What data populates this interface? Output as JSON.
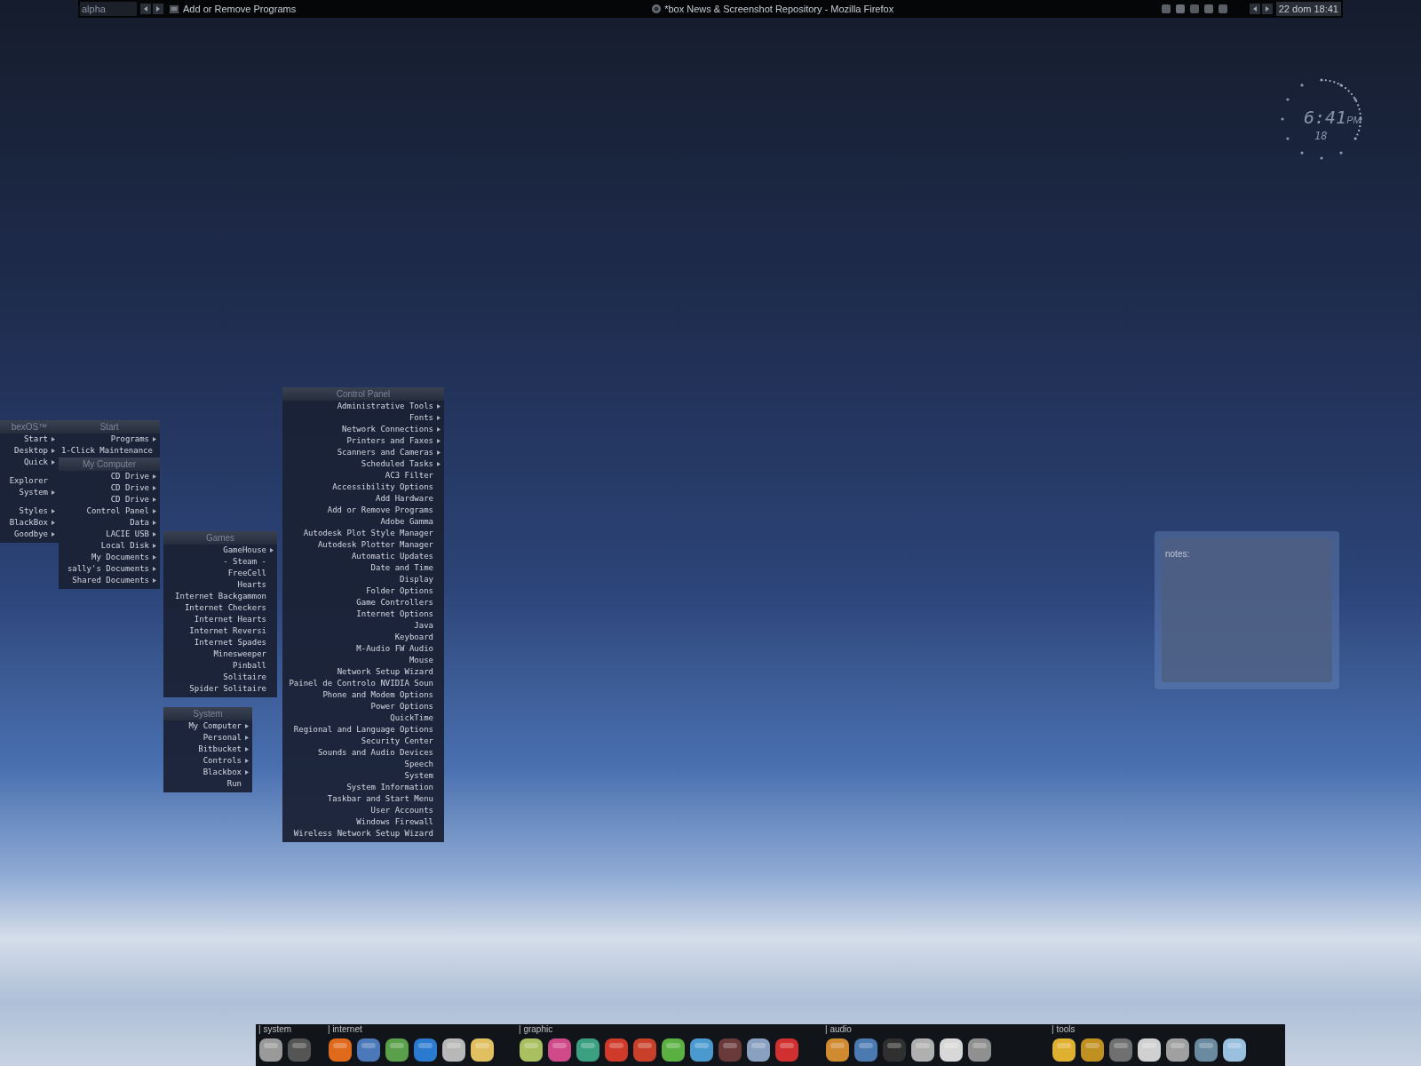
{
  "top_bar": {
    "workspace": "alpha",
    "window_label": "Add or Remove Programs",
    "title": "*box News & Screenshot Repository - Mozilla Firefox",
    "clock": "22 dom 18:41"
  },
  "clock_widget": {
    "time": "6:41",
    "suffix": "PM",
    "day": "18"
  },
  "notes": {
    "label": "notes:"
  },
  "menus": [
    {
      "title": "bexOS™",
      "groups": [
        [
          {
            "label": "Start",
            "submenu": true
          },
          {
            "label": "Desktop",
            "submenu": true
          },
          {
            "label": "Quick",
            "submenu": true
          }
        ],
        [
          {
            "label": "Explorer",
            "submenu": false
          },
          {
            "label": "System",
            "submenu": true
          }
        ],
        [
          {
            "label": "Styles",
            "submenu": true
          },
          {
            "label": "BlackBox",
            "submenu": true
          },
          {
            "label": "Goodbye",
            "submenu": true
          }
        ]
      ]
    },
    {
      "title": "Start",
      "groups": [
        [
          {
            "label": "Programs",
            "submenu": true
          },
          {
            "label": "1-Click Maintenance",
            "submenu": false
          }
        ]
      ]
    },
    {
      "title": "My Computer",
      "groups": [
        [
          {
            "label": "CD Drive",
            "submenu": true
          },
          {
            "label": "CD Drive",
            "submenu": true
          },
          {
            "label": "CD Drive",
            "submenu": true
          },
          {
            "label": "Control Panel",
            "submenu": true
          },
          {
            "label": "Data",
            "submenu": true
          },
          {
            "label": "LACIE USB",
            "submenu": true
          },
          {
            "label": "Local Disk",
            "submenu": true
          },
          {
            "label": "My Documents",
            "submenu": true
          },
          {
            "label": "sally's Documents",
            "submenu": true
          },
          {
            "label": "Shared Documents",
            "submenu": true
          }
        ]
      ]
    },
    {
      "title": "Games",
      "groups": [
        [
          {
            "label": "GameHouse",
            "submenu": true
          },
          {
            "label": "- Steam -",
            "submenu": false
          },
          {
            "label": "FreeCell",
            "submenu": false
          },
          {
            "label": "Hearts",
            "submenu": false
          },
          {
            "label": "Internet Backgammon",
            "submenu": false
          },
          {
            "label": "Internet Checkers",
            "submenu": false
          },
          {
            "label": "Internet Hearts",
            "submenu": false
          },
          {
            "label": "Internet Reversi",
            "submenu": false
          },
          {
            "label": "Internet Spades",
            "submenu": false
          },
          {
            "label": "Minesweeper",
            "submenu": false
          },
          {
            "label": "Pinball",
            "submenu": false
          },
          {
            "label": "Solitaire",
            "submenu": false
          },
          {
            "label": "Spider Solitaire",
            "submenu": false
          }
        ]
      ]
    },
    {
      "title": "System",
      "groups": [
        [
          {
            "label": "My Computer",
            "submenu": true
          },
          {
            "label": "Personal",
            "submenu": true
          },
          {
            "label": "Bitbucket",
            "submenu": true
          },
          {
            "label": "Controls",
            "submenu": true
          },
          {
            "label": "Blackbox",
            "submenu": true
          },
          {
            "label": "Run",
            "submenu": false
          }
        ]
      ]
    },
    {
      "title": "Control Panel",
      "groups": [
        [
          {
            "label": "Administrative Tools",
            "submenu": true
          },
          {
            "label": "Fonts",
            "submenu": true
          },
          {
            "label": "Network Connections",
            "submenu": true
          },
          {
            "label": "Printers and Faxes",
            "submenu": true
          },
          {
            "label": "Scanners and Cameras",
            "submenu": true
          },
          {
            "label": "Scheduled Tasks",
            "submenu": true
          },
          {
            "label": "AC3 Filter",
            "submenu": false
          },
          {
            "label": "Accessibility Options",
            "submenu": false
          },
          {
            "label": "Add Hardware",
            "submenu": false
          },
          {
            "label": "Add or Remove Programs",
            "submenu": false
          },
          {
            "label": "Adobe Gamma",
            "submenu": false
          },
          {
            "label": "Autodesk Plot Style Manager",
            "submenu": false
          },
          {
            "label": "Autodesk Plotter Manager",
            "submenu": false
          },
          {
            "label": "Automatic Updates",
            "submenu": false
          },
          {
            "label": "Date and Time",
            "submenu": false
          },
          {
            "label": "Display",
            "submenu": false
          },
          {
            "label": "Folder Options",
            "submenu": false
          },
          {
            "label": "Game Controllers",
            "submenu": false
          },
          {
            "label": "Internet Options",
            "submenu": false
          },
          {
            "label": "Java",
            "submenu": false
          },
          {
            "label": "Keyboard",
            "submenu": false
          },
          {
            "label": "M-Audio FW Audio",
            "submenu": false
          },
          {
            "label": "Mouse",
            "submenu": false
          },
          {
            "label": "Network Setup Wizard",
            "submenu": false
          },
          {
            "label": "Painel de Controlo NVIDIA Soun",
            "submenu": false
          },
          {
            "label": "Phone and Modem Options",
            "submenu": false
          },
          {
            "label": "Power Options",
            "submenu": false
          },
          {
            "label": "QuickTime",
            "submenu": false
          },
          {
            "label": "Regional and Language Options",
            "submenu": false
          },
          {
            "label": "Security Center",
            "submenu": false
          },
          {
            "label": "Sounds and Audio Devices",
            "submenu": false
          },
          {
            "label": "Speech",
            "submenu": false
          },
          {
            "label": "System",
            "submenu": false
          },
          {
            "label": "System Information",
            "submenu": false
          },
          {
            "label": "Taskbar and Start Menu",
            "submenu": false
          },
          {
            "label": "User Accounts",
            "submenu": false
          },
          {
            "label": "Windows Firewall",
            "submenu": false
          },
          {
            "label": "Wireless Network Setup Wizard",
            "submenu": false
          }
        ]
      ]
    }
  ],
  "dock": {
    "sections": [
      {
        "label": "| system",
        "icons": [
          {
            "color": "#9a9a9a"
          },
          {
            "color": "#555555"
          }
        ]
      },
      {
        "label": "| internet",
        "icons": [
          {
            "color": "#e06a1c"
          },
          {
            "color": "#4a78b8"
          },
          {
            "color": "#5aa04a"
          },
          {
            "color": "#2a7ad0"
          },
          {
            "color": "#b8b8b8"
          },
          {
            "color": "#e0c060"
          }
        ]
      },
      {
        "label": "| graphic",
        "icons": [
          {
            "color": "#a8c060"
          },
          {
            "color": "#d04a8a"
          },
          {
            "color": "#3aa080"
          },
          {
            "color": "#d03a2a"
          },
          {
            "color": "#c8402a"
          },
          {
            "color": "#5ab040"
          },
          {
            "color": "#4a9ad0"
          },
          {
            "color": "#6a3a3a"
          },
          {
            "color": "#8aa0c0"
          },
          {
            "color": "#d03030"
          }
        ]
      },
      {
        "label": "| audio",
        "icons": [
          {
            "color": "#d08a30"
          },
          {
            "color": "#4a7ab0"
          },
          {
            "color": "#303030"
          },
          {
            "color": "#b0b0b0"
          },
          {
            "color": "#d8d8d8"
          },
          {
            "color": "#909090"
          }
        ]
      },
      {
        "label": "| tools",
        "icons": [
          {
            "color": "#e0b030"
          },
          {
            "color": "#c09020"
          },
          {
            "color": "#707070"
          },
          {
            "color": "#d0d0d0"
          },
          {
            "color": "#a0a0a0"
          },
          {
            "color": "#6a8aa0"
          },
          {
            "color": "#9ac0e0"
          }
        ]
      }
    ]
  }
}
